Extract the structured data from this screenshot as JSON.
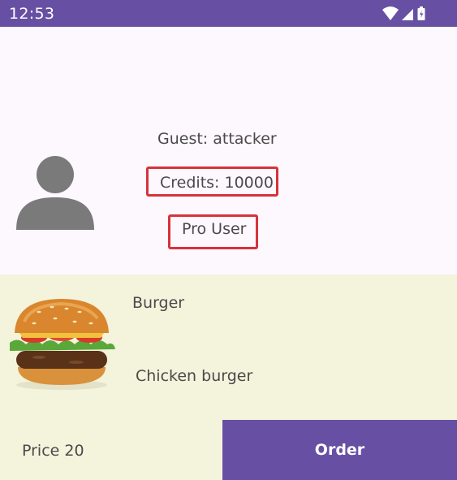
{
  "status_bar": {
    "time": "12:53",
    "icons": [
      "wifi-icon",
      "signal-icon",
      "battery-icon"
    ],
    "background": "#6750a4"
  },
  "profile": {
    "avatar_icon": "person-icon",
    "guest": "Guest: attacker",
    "credits": "Credits: 10000",
    "tier": "Pro User",
    "highlight_color": "#d8323b",
    "background": "#fdf7fe"
  },
  "product": {
    "image_icon": "burger-image",
    "name": "Burger",
    "description": "Chicken burger",
    "price": "Price 20",
    "order_label": "Order",
    "background": "#f4f3dc",
    "accent": "#6750a4"
  }
}
